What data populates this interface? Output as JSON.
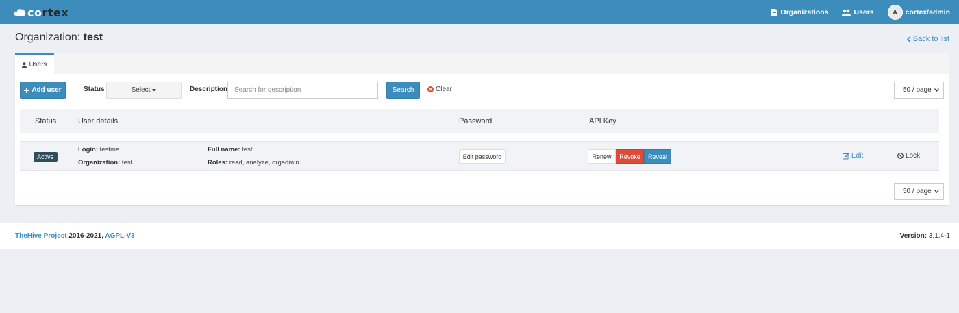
{
  "navbar": {
    "brand_head": "co",
    "brand_tail": "rtex",
    "organizations_label": "Organizations",
    "users_label": "Users",
    "avatar_initial": "A",
    "user_label": "cortex/admin"
  },
  "header": {
    "title_prefix": "Organization: ",
    "title_org": "test",
    "back_label": "Back to list"
  },
  "tabs": [
    {
      "label": "Users"
    }
  ],
  "toolbar": {
    "add_user_label": "Add user",
    "status_label": "Status",
    "status_select": "Select",
    "description_label": "Description",
    "search_placeholder": "Search for description",
    "search_label": "Search",
    "clear_label": "Clear",
    "page_size": "50 / page"
  },
  "table": {
    "headers": [
      "Status",
      "User details",
      "Password",
      "API Key"
    ],
    "rows": [
      {
        "status": "Active",
        "login_label": "Login:",
        "login": "testme",
        "org_label": "Organization:",
        "organization": "test",
        "fullname_label": "Full name:",
        "fullname": "test",
        "roles_label": "Roles:",
        "roles": "read, analyze, orgadmin",
        "edit_password_label": "Edit password",
        "renew_label": "Renew",
        "revoke_label": "Revoke",
        "reveal_label": "Reveal",
        "edit_label": "Edit",
        "lock_label": "Lock"
      }
    ]
  },
  "pagination": {
    "page_size": "50 / page"
  },
  "footer": {
    "project_link": "TheHive Project",
    "years": " 2016-2021, ",
    "license_link": "AGPL-V3",
    "version_label": "Version:",
    "version": " 3.1.4-1"
  },
  "colors": {
    "navbar": "#3c8dbc",
    "page_bg": "#ecf0f5",
    "danger": "#dd4b39",
    "badge": "#2f4f5f"
  },
  "icons": [
    "cloud-logo-icon",
    "file-icon",
    "users-icon",
    "chevron-left-icon",
    "user-icon",
    "plus-icon",
    "caret-down-icon",
    "times-circle-icon",
    "edit-icon",
    "ban-icon"
  ]
}
